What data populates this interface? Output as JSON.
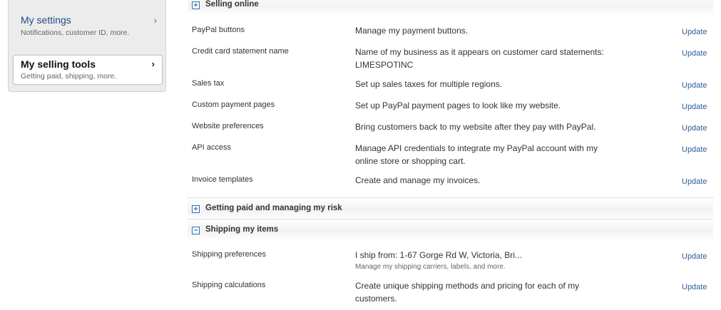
{
  "sidebar": {
    "items": [
      {
        "title": "My settings",
        "subtitle": "Notifications, customer ID, more.",
        "chevron": "›"
      },
      {
        "title": "My selling tools",
        "subtitle": "Getting paid, shipping, more.",
        "chevron": "›"
      }
    ]
  },
  "sections": {
    "selling_online": {
      "toggle": "+",
      "title": "Selling online",
      "rows": [
        {
          "label": "PayPal buttons",
          "desc": "Manage my payment buttons.",
          "action": "Update"
        },
        {
          "label": "Credit card statement name",
          "desc": "Name of my business as it appears on customer card statements: LIMESPOTINC",
          "action": "Update"
        },
        {
          "label": "Sales tax",
          "desc": "Set up sales taxes for multiple regions.",
          "action": "Update"
        },
        {
          "label": "Custom payment pages",
          "desc": "Set up PayPal payment pages to look like my website.",
          "action": "Update"
        },
        {
          "label": "Website preferences",
          "desc": "Bring customers back to my website after they pay with PayPal.",
          "action": "Update"
        },
        {
          "label": "API access",
          "desc": "Manage API credentials to integrate my PayPal account with my online store or shopping cart.",
          "action": "Update"
        },
        {
          "label": "Invoice templates",
          "desc": "Create and manage my invoices.",
          "action": "Update"
        }
      ]
    },
    "getting_paid": {
      "toggle": "+",
      "title": "Getting paid and managing my risk"
    },
    "shipping": {
      "toggle": "−",
      "title": "Shipping my items",
      "rows": [
        {
          "label": "Shipping preferences",
          "desc": "I ship from: 1-67 Gorge Rd W, Victoria, Bri...",
          "note": "Manage my shipping carriers, labels, and more.",
          "action": "Update"
        },
        {
          "label": "Shipping calculations",
          "desc": "Create unique shipping methods and pricing for each of my customers.",
          "action": "Update"
        }
      ]
    }
  }
}
